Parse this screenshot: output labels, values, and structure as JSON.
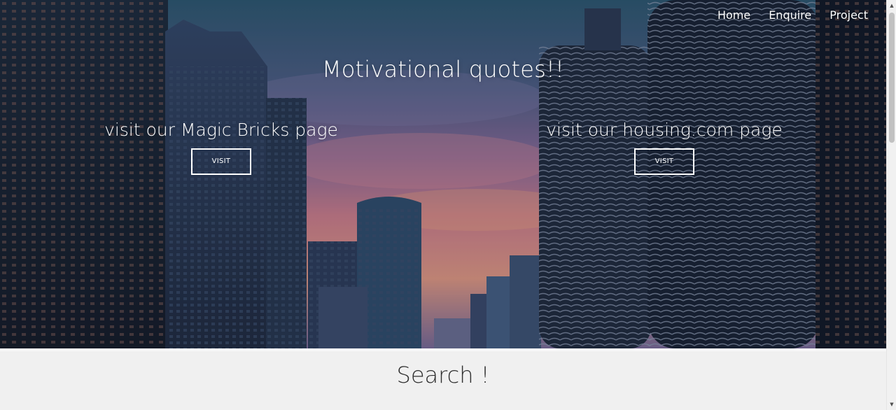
{
  "nav": {
    "items": [
      {
        "label": "Home"
      },
      {
        "label": "Enquire"
      },
      {
        "label": "Project"
      }
    ]
  },
  "hero": {
    "title": "Motivational quotes!!",
    "promos": [
      {
        "text": "visit our Magic Bricks page",
        "button_label": "VISIT"
      },
      {
        "text": "visit our housing.com page",
        "button_label": "VISIT"
      }
    ]
  },
  "search": {
    "title": "Search !"
  },
  "scrollbar": {
    "up_icon": "scroll-up-arrow",
    "down_icon": "scroll-down-arrow"
  },
  "colors": {
    "text_on_hero": "#ffffff",
    "search_bg": "#f0f0f0",
    "search_text": "#2f2f2f"
  }
}
